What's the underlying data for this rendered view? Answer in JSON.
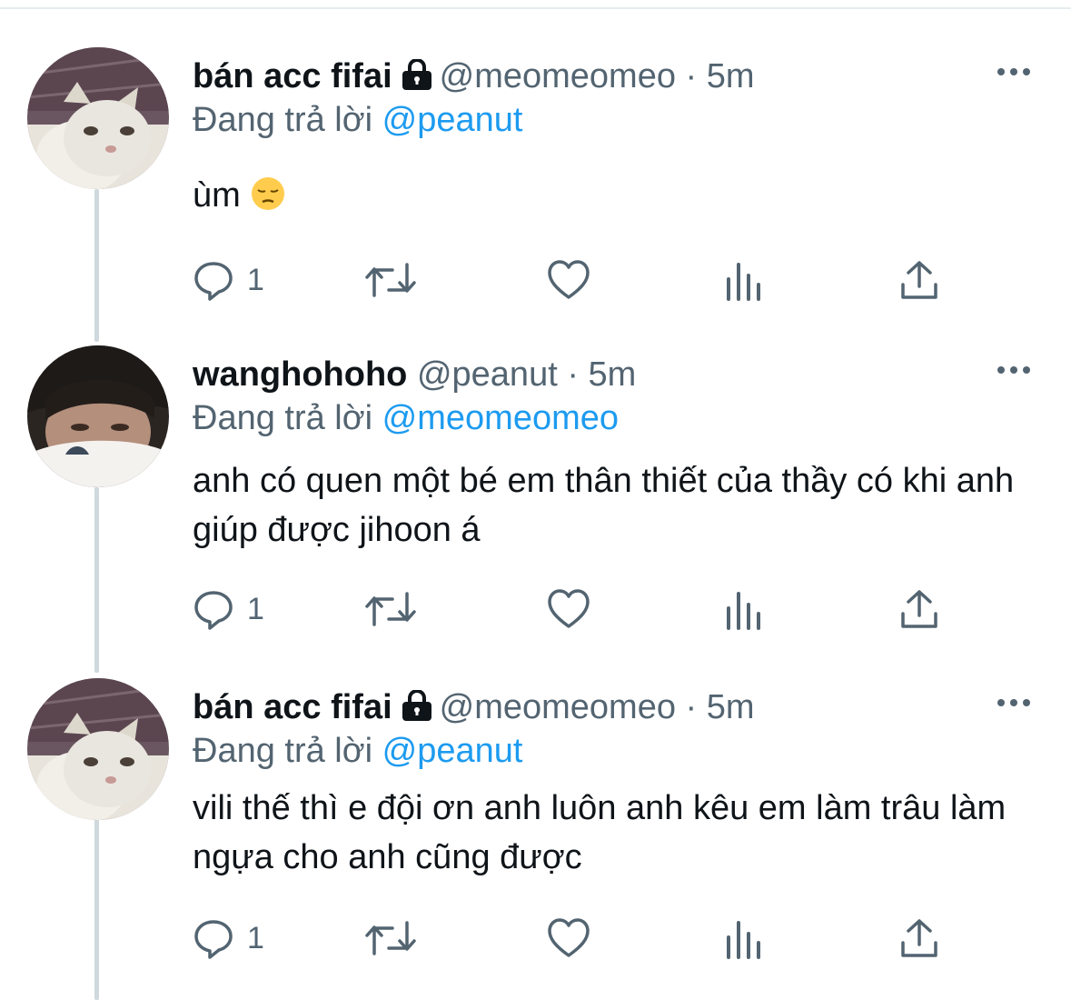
{
  "colors": {
    "text": "#0f1419",
    "secondary": "#536471",
    "accent": "#1d9bf0",
    "divider": "#cfd9de"
  },
  "tweets": [
    {
      "author_name": "bán acc fifai",
      "locked": true,
      "handle": "@meomeomeo",
      "separator": "·",
      "time": "5m",
      "replying_prefix": "Đang trả lời",
      "replying_to": "@peanut",
      "text": "ùm",
      "emoji": "pensive-face",
      "reply_count": "1",
      "avatar": "cat-avatar"
    },
    {
      "author_name": "wanghohoho",
      "locked": false,
      "handle": "@peanut",
      "separator": "·",
      "time": "5m",
      "replying_prefix": "Đang trả lời",
      "replying_to": "@meomeomeo",
      "text": "anh có quen một bé em thân thiết của thầy có khi anh giúp được jihoon á",
      "reply_count": "1",
      "avatar": "person-avatar"
    },
    {
      "author_name": "bán acc fifai",
      "locked": true,
      "handle": "@meomeomeo",
      "separator": "·",
      "time": "5m",
      "replying_prefix": "Đang trả lời",
      "replying_to": "@peanut",
      "text": "vili thế thì e đội ơn anh luôn anh kêu em làm trâu làm ngựa cho anh cũng được",
      "reply_count": "1",
      "avatar": "cat-avatar"
    }
  ],
  "icons": [
    "reply-icon",
    "retweet-icon",
    "like-icon",
    "analytics-icon",
    "share-icon",
    "more-icon",
    "lock-icon"
  ]
}
